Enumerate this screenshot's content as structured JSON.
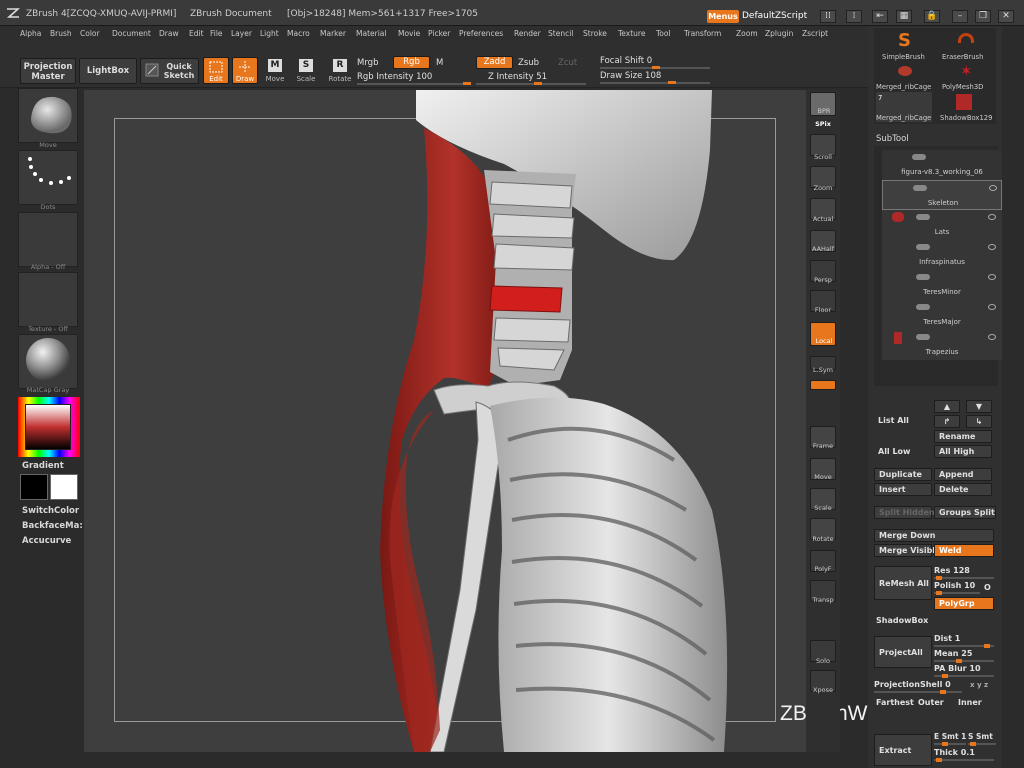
{
  "titlebar": {
    "app": "ZBrush 4[ZCQQ-XMUQ-AVIJ-PRMI]",
    "document": "ZBrush Document",
    "stats": "[Obj>18248]  Mem>561+1317  Free>1705",
    "menus_label": "Menus",
    "script_label": "DefaultZScript"
  },
  "menubar": [
    "Alpha",
    "Brush",
    "Color",
    "Document",
    "Draw",
    "Edit",
    "File",
    "Layer",
    "Light",
    "Macro",
    "Marker",
    "Material",
    "Movie",
    "Picker",
    "Preferences",
    "Render",
    "Stencil",
    "Stroke",
    "Texture",
    "Tool",
    "Transform",
    "Zoom",
    "Zplugin",
    "Zscript"
  ],
  "toolbar": {
    "projection_master": "Projection Master",
    "lightbox": "LightBox",
    "quick_sketch": "Quick Sketch",
    "edit": "Edit",
    "draw": "Draw",
    "move": "Move",
    "scale": "Scale",
    "rotate": "Rotate",
    "mrgb": "Mrgb",
    "rgb": "Rgb",
    "m": "M",
    "rgb_intensity": "Rgb Intensity 100",
    "zadd": "Zadd",
    "zsub": "Zsub",
    "zcut": "Zcut",
    "z_intensity": "Z Intensity 51",
    "focal_shift": "Focal Shift 0",
    "draw_size": "Draw Size 108"
  },
  "left": {
    "thumbs": [
      "Move",
      "Dots",
      "Alpha - Off",
      "Texture - Off",
      "MatCap Gray"
    ],
    "gradient": "Gradient",
    "switch_color": "SwitchColor",
    "backface": "BackfaceMa:",
    "accucurve": "Accucurve"
  },
  "shelf": [
    "BPR",
    "SPix",
    "Scroll",
    "Zoom",
    "Actual",
    "AAHalf",
    "Persp",
    "Floor",
    "Local",
    "L.Sym",
    "Frame",
    "Move",
    "Scale",
    "Rotate",
    "PolyF",
    "Transp",
    "Solo",
    "Xpose"
  ],
  "right": {
    "brushes": [
      "SimpleBrush",
      "EraserBrush",
      "Merged_ribCage",
      "PolyMesh3D",
      "Merged_ribCage",
      "ShadowBox129"
    ],
    "brush_count": "7",
    "subtool_header": "SubTool",
    "subtools": [
      "figura-v8.3_working_06",
      "Skeleton",
      "Lats",
      "Infraspinatus",
      "TeresMinor",
      "TeresMajor",
      "Trapezius"
    ],
    "list_all": "List All",
    "rename": "Rename",
    "all_low": "All Low",
    "all_high": "All High",
    "duplicate": "Duplicate",
    "append": "Append",
    "insert": "Insert",
    "delete": "Delete",
    "split_hidden": "Split Hidden",
    "groups_split": "Groups Split",
    "merge_down": "Merge Down",
    "merge_visible": "Merge Visibl",
    "weld": "Weld",
    "remesh_all": "ReMesh All",
    "res": "Res 128",
    "polish": "Polish 10",
    "polish_o": "O",
    "polygrp": "PolyGrp",
    "shadowbox": "ShadowBox",
    "project_all": "ProjectAll",
    "dist": "Dist 1",
    "mean": "Mean 25",
    "pa_blur": "PA Blur 10",
    "projection_shell": "ProjectionShell 0",
    "farthest": "Farthest",
    "outer": "Outer",
    "inner": "Inner",
    "extract": "Extract",
    "e_smt": "E Smt 1",
    "s_smt": "S Smt",
    "thick": "Thick 0.1"
  },
  "watermark": "ZBrushWorkshops",
  "colors": {
    "accent": "#e8761c",
    "muscle": "#a3251e",
    "bone": "#cfcfcf",
    "bg": "#2b2b2b"
  }
}
